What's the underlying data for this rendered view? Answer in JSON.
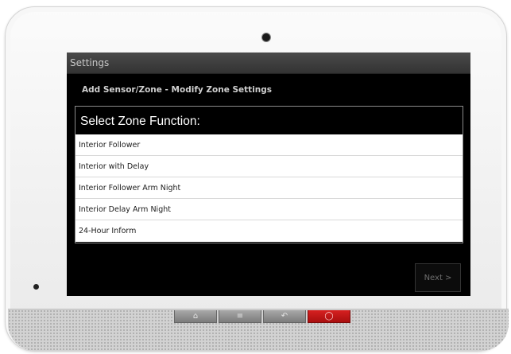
{
  "app_title": "Settings",
  "page_heading": "Add Sensor/Zone - Modify Zone Settings",
  "dialog": {
    "title": "Select Zone Function:",
    "options": [
      {
        "label": "Interior Follower"
      },
      {
        "label": "Interior with Delay"
      },
      {
        "label": "Interior Follower Arm Night"
      },
      {
        "label": "Interior Delay Arm Night"
      },
      {
        "label": "24-Hour Inform"
      }
    ]
  },
  "next_button": {
    "label": "Next >"
  },
  "hardware_buttons": [
    {
      "icon": "home-icon",
      "glyph": "⌂"
    },
    {
      "icon": "menu-icon",
      "glyph": "≡"
    },
    {
      "icon": "back-icon",
      "glyph": "↶"
    },
    {
      "icon": "panic-icon",
      "glyph": "◯"
    }
  ],
  "colors": {
    "screen_bg": "#000000",
    "title_bar": "#3c3c3c",
    "panic_button": "#c81818"
  }
}
